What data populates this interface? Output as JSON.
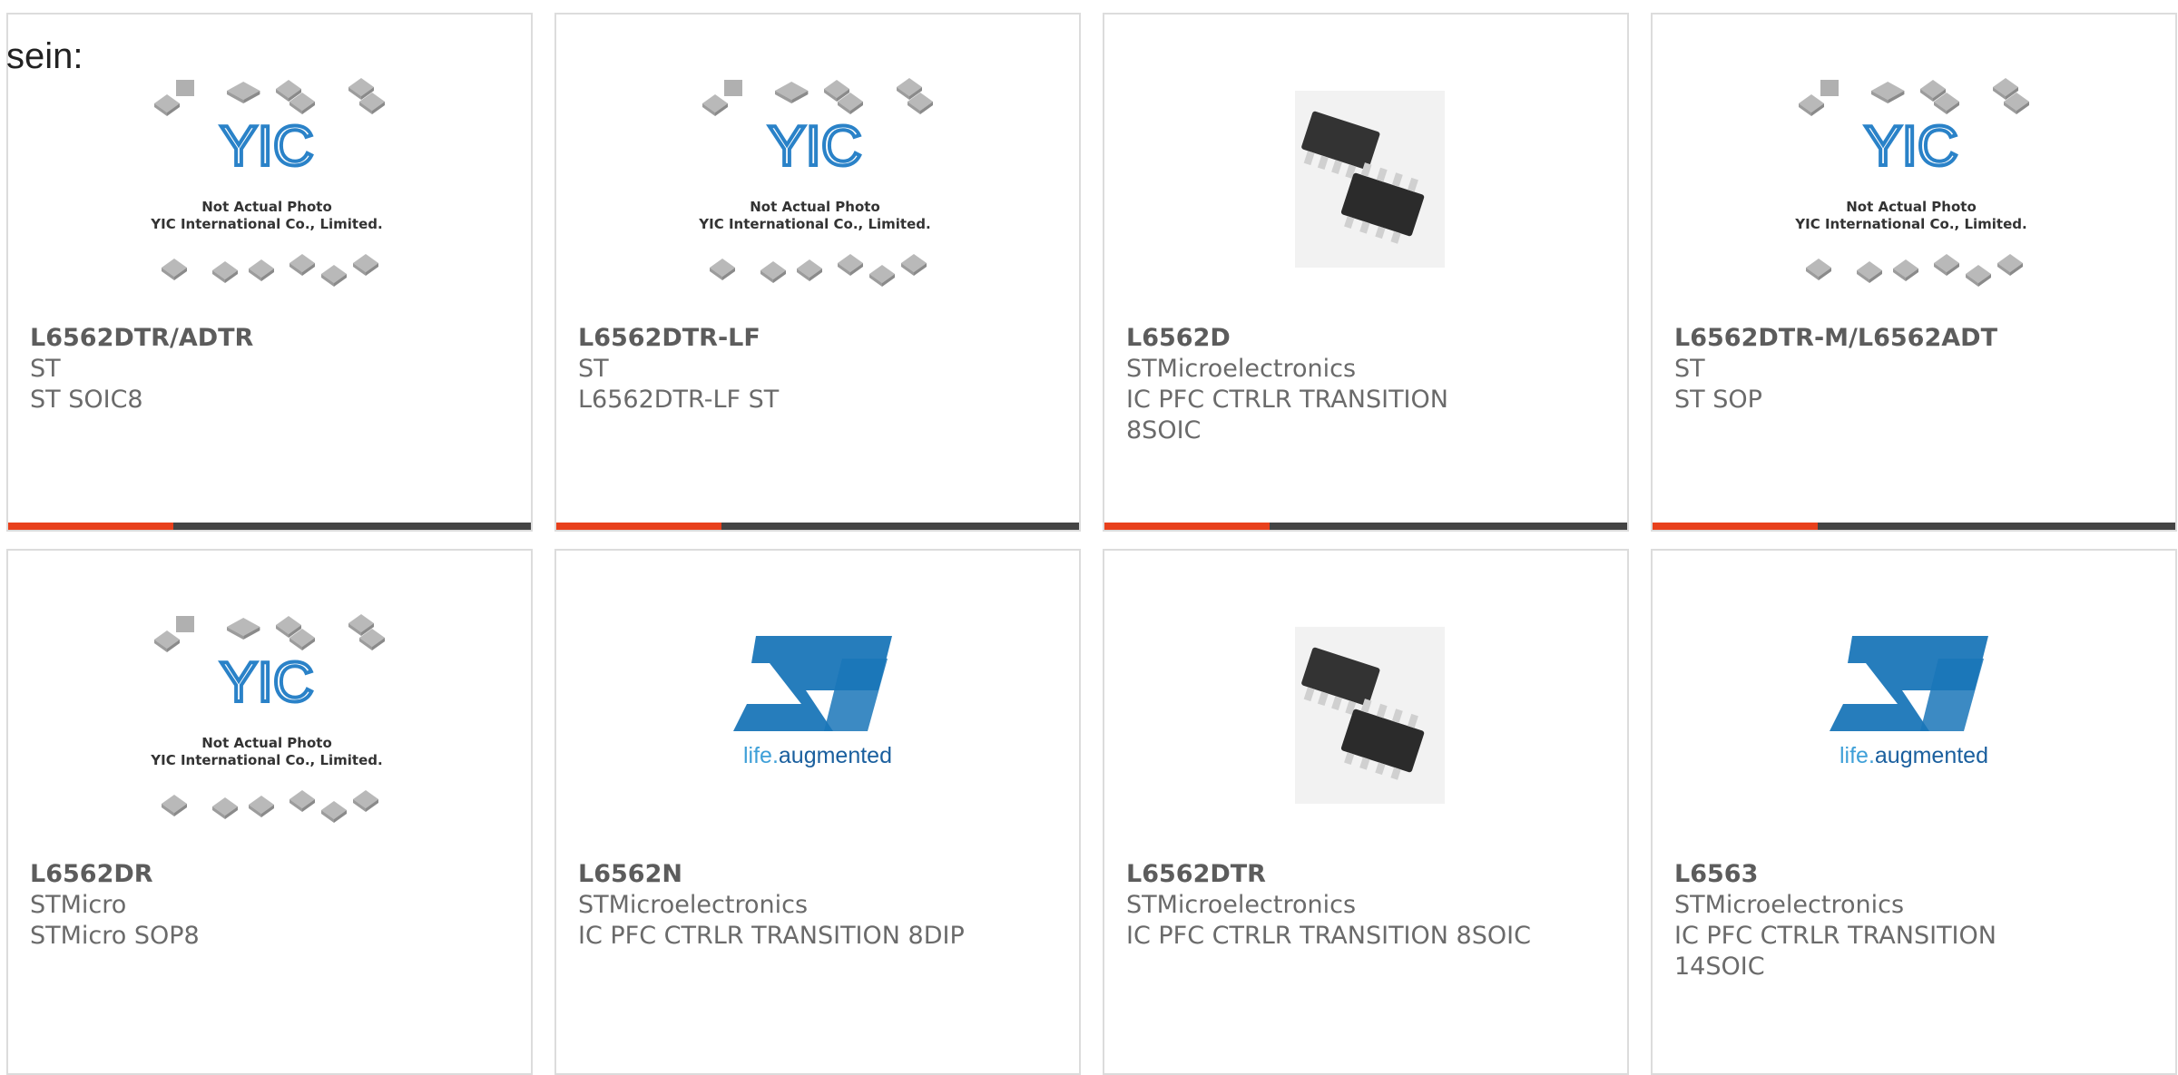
{
  "intro_text": "sein:",
  "colors": {
    "accent": "#e8401c",
    "bar": "#444444",
    "yic_blue": "#2a82c8",
    "st_blue": "#1a76b8"
  },
  "placeholder": {
    "line1": "Not Actual Photo",
    "line2": "YIC International Co., Limited.",
    "logo": "YIC"
  },
  "st_logo": {
    "mark": "ST",
    "tagline_a": "life.",
    "tagline_b": "augmented"
  },
  "products": [
    {
      "part_number": "L6562DTR/ADTR",
      "manufacturer": "ST",
      "description": "ST SOIC8",
      "image": "yic-placeholder-icon"
    },
    {
      "part_number": "L6562DTR-LF",
      "manufacturer": "ST",
      "description": "L6562DTR-LF ST",
      "image": "yic-placeholder-icon"
    },
    {
      "part_number": "L6562D",
      "manufacturer": "STMicroelectronics",
      "description": "IC PFC CTRLR TRANSITION 8SOIC",
      "image": "soic-chip-icon"
    },
    {
      "part_number": "L6562DTR-M/L6562ADT",
      "manufacturer": "ST",
      "description": "ST SOP",
      "image": "yic-placeholder-icon"
    },
    {
      "part_number": "L6562DR",
      "manufacturer": "STMicro",
      "description": "STMicro SOP8",
      "image": "yic-placeholder-icon"
    },
    {
      "part_number": "L6562N",
      "manufacturer": "STMicroelectronics",
      "description": "IC PFC CTRLR TRANSITION 8DIP",
      "image": "st-logo-icon"
    },
    {
      "part_number": "L6562DTR",
      "manufacturer": "STMicroelectronics",
      "description": "IC PFC CTRLR TRANSITION 8SOIC",
      "image": "soic-chip-icon"
    },
    {
      "part_number": "L6563",
      "manufacturer": "STMicroelectronics",
      "description": "IC PFC CTRLR TRANSITION 14SOIC",
      "image": "st-logo-icon"
    }
  ]
}
